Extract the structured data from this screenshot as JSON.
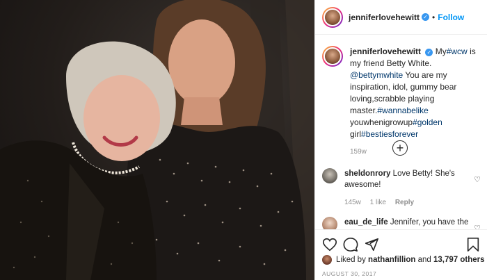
{
  "post": {
    "username": "jenniferlovehewitt",
    "follow_label": "Follow",
    "separator": "•",
    "caption": {
      "pre": "My",
      "tag1": "#wcw",
      "t1": " is my friend Betty White. ",
      "mention": "@bettymwhite",
      "t2": " You are my inspiration, idol, gummy bear loving,scrabble playing master.",
      "tag2": "#wannabelike",
      "t3": " youwhenigrowup",
      "tag3": "#golden",
      "t4": " girl",
      "tag4": "#bestiesforever",
      "time": "159w"
    },
    "comments": [
      {
        "user": "sheldonrory",
        "text": "Love Betty! She's awesome!",
        "age": "145w",
        "likes": "1 like",
        "reply": "Reply"
      },
      {
        "user": "eau_de_life",
        "text": "Jennifer, you have the"
      }
    ],
    "liked_by_prefix": "Liked by",
    "liked_by_user": "nathanfillion",
    "liked_by_and": "and",
    "liked_by_others": "13,797 others",
    "date": "AUGUST 30, 2017"
  },
  "icons": {
    "verified": "verified-badge-icon",
    "load_more": "plus-circle-icon",
    "like": "heart-icon",
    "comment": "comment-bubble-icon",
    "share": "paper-plane-icon",
    "save": "bookmark-icon"
  },
  "colors": {
    "link": "#0095f6",
    "tag": "#00376b",
    "verified": "#3897f0",
    "muted": "#8e8e8e"
  }
}
